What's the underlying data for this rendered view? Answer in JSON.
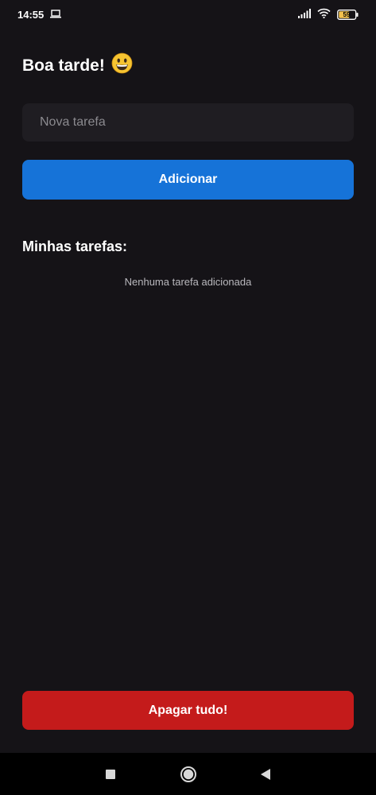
{
  "status_bar": {
    "time": "14:55",
    "battery_level": "59",
    "icons": [
      "laptop-icon",
      "signal-icon",
      "wifi-icon",
      "battery-icon"
    ]
  },
  "header": {
    "greeting": "Boa tarde!",
    "emoji_icon": "grinning-face-icon"
  },
  "form": {
    "input_placeholder": "Nova tarefa",
    "input_value": "",
    "add_button_label": "Adicionar"
  },
  "tasks": {
    "title": "Minhas tarefas:",
    "empty_message": "Nenhuma tarefa adicionada",
    "items": []
  },
  "footer": {
    "delete_all_label": "Apagar tudo!"
  },
  "nav_bar": {
    "buttons": [
      "recents-square-icon",
      "home-circle-icon",
      "back-triangle-icon"
    ]
  },
  "colors": {
    "background": "#151317",
    "input_background": "#1f1d22",
    "primary": "#1673d8",
    "danger": "#c41b1b",
    "battery_fill": "#f2c14e"
  }
}
